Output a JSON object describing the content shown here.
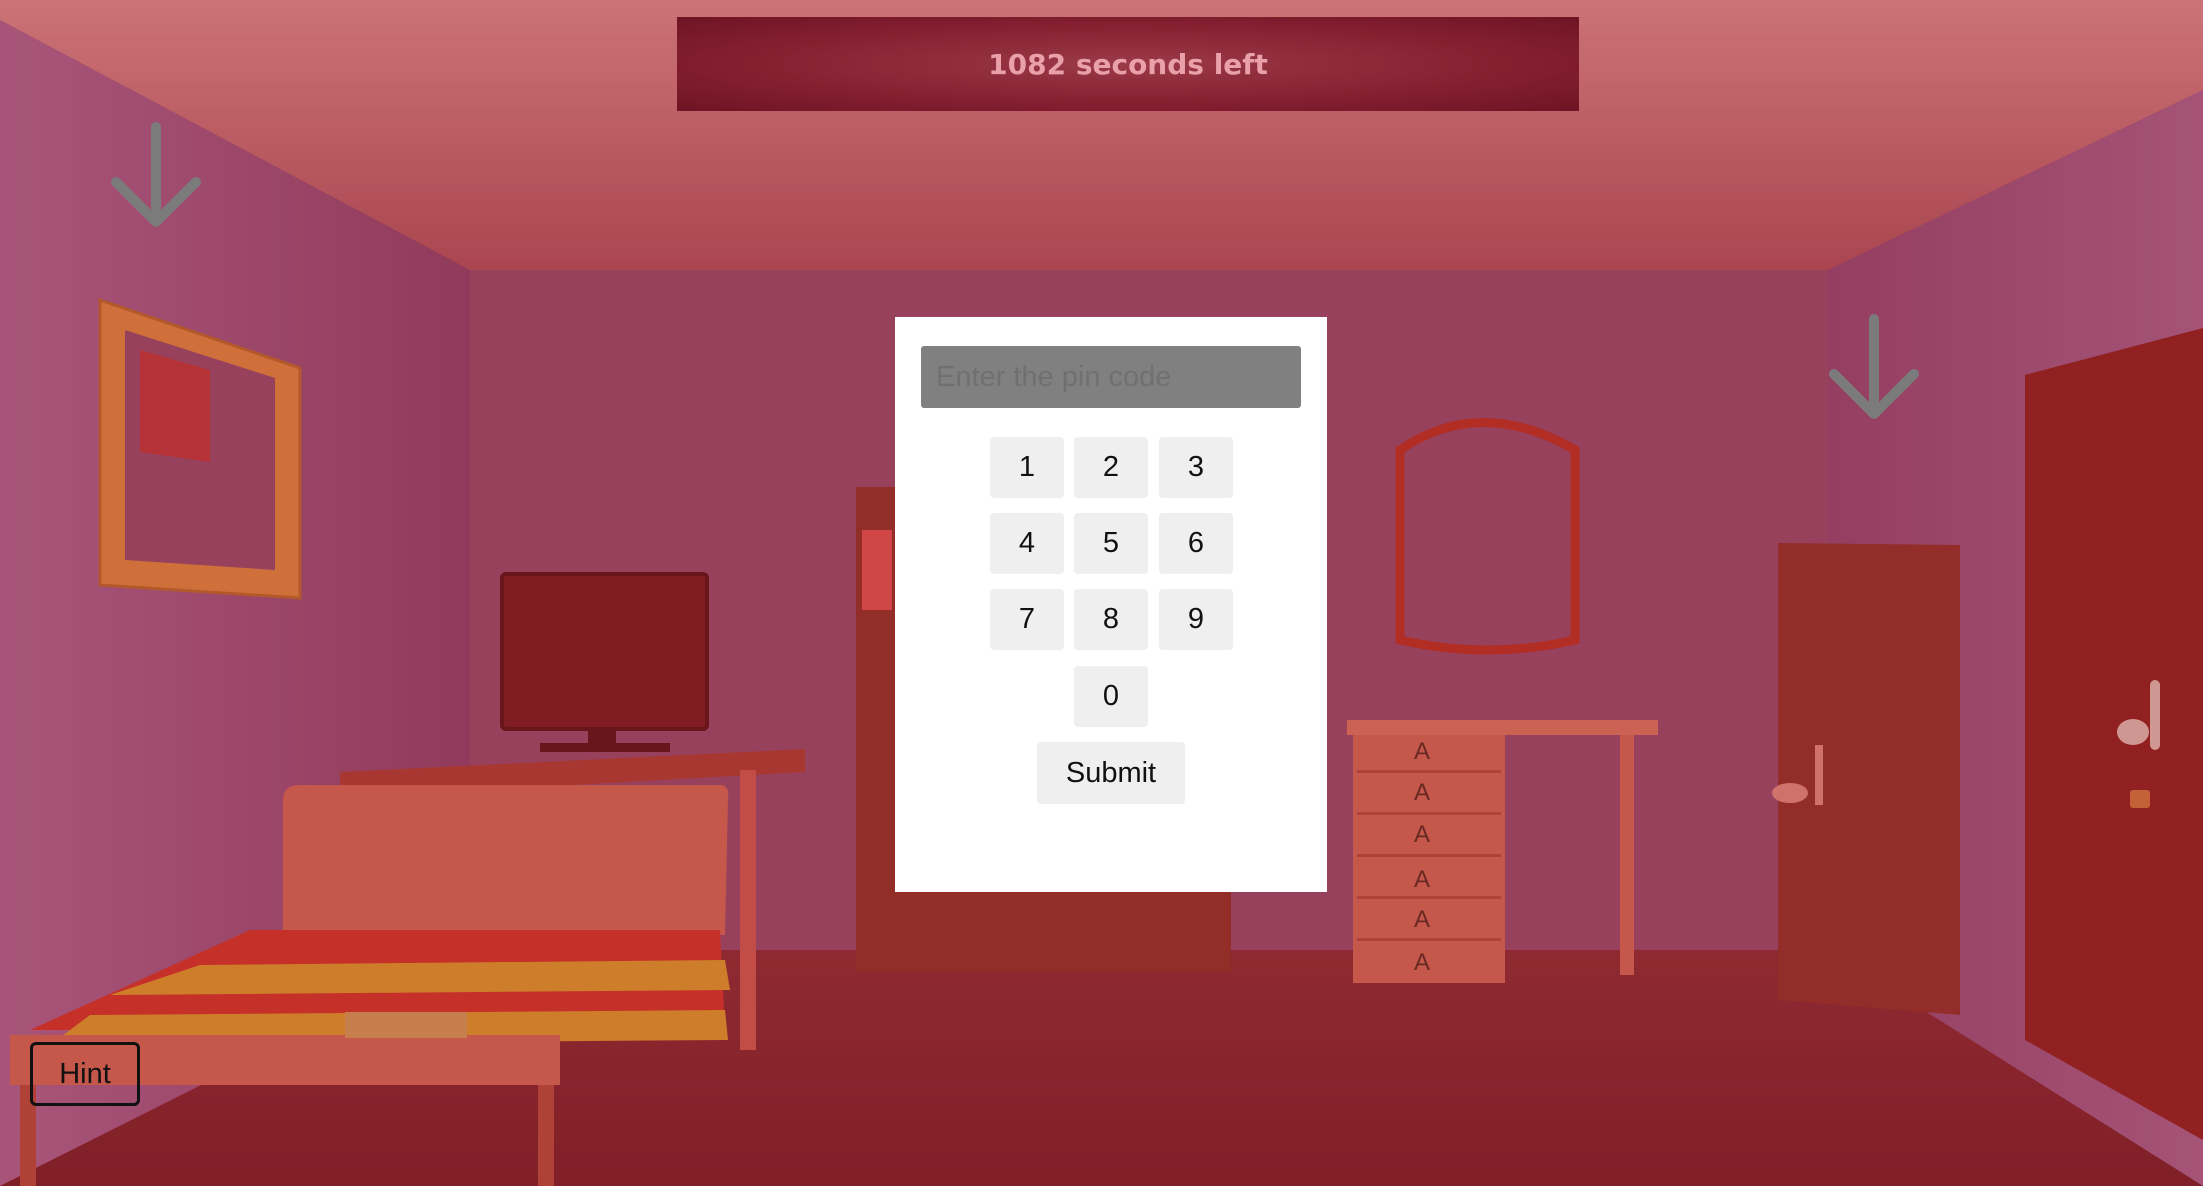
{
  "timer": {
    "text": "1082 seconds left"
  },
  "pin_pad": {
    "placeholder": "Enter the pin code",
    "keys": [
      "1",
      "2",
      "3",
      "4",
      "5",
      "6",
      "7",
      "8",
      "9",
      "0"
    ],
    "submit_label": "Submit"
  },
  "hint_label": "Hint",
  "drawer_labels": [
    "A",
    "A",
    "A",
    "A",
    "A",
    "A"
  ],
  "nav": {
    "left_icon": "down-arrow-icon",
    "right_icon": "down-arrow-icon"
  },
  "colors": {
    "overlay": "#b42828",
    "timer_bg": "#841f30",
    "timer_text": "#e9a0a8",
    "modal_bg": "#ffffff",
    "input_bg": "#808080",
    "key_bg": "#efefef"
  }
}
